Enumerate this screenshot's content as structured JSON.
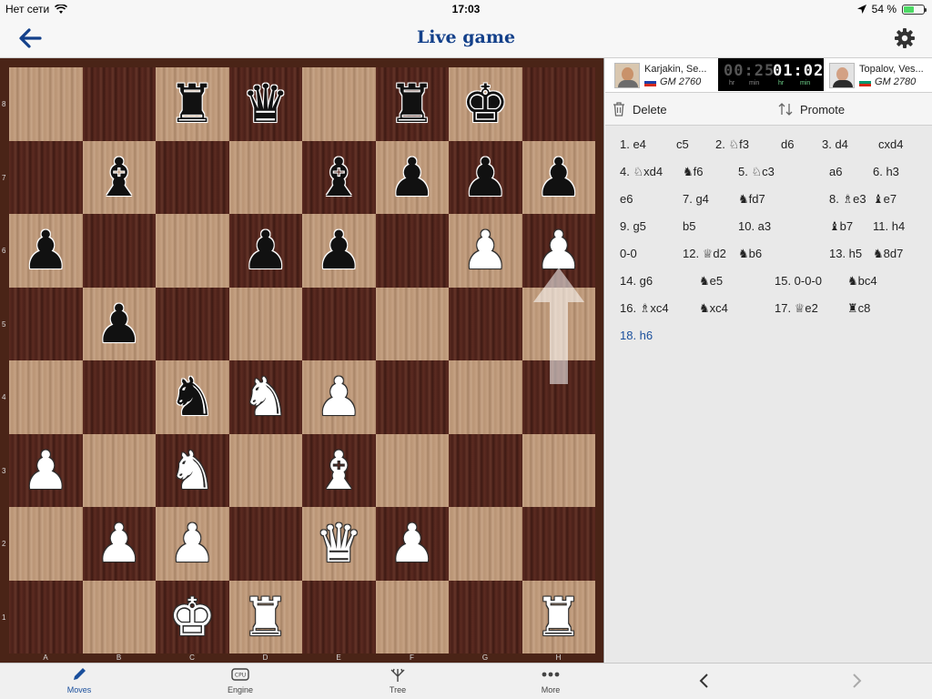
{
  "status_bar": {
    "network": "Нет сети",
    "time": "17:03",
    "battery_percent": "54 %",
    "battery_level": 0.54
  },
  "nav": {
    "title": "Live game"
  },
  "board": {
    "ranks": [
      "8",
      "7",
      "6",
      "5",
      "4",
      "3",
      "2",
      "1"
    ],
    "files": [
      "A",
      "B",
      "C",
      "D",
      "E",
      "F",
      "G",
      "H"
    ],
    "position": [
      [
        "",
        "",
        "bR",
        "bQ",
        "",
        "bR",
        "bK",
        ""
      ],
      [
        "",
        "bB",
        "",
        "",
        "bB",
        "bP",
        "bP",
        "bP"
      ],
      [
        "bP",
        "",
        "",
        "bP",
        "bP",
        "",
        "wP",
        "wP"
      ],
      [
        "",
        "bP",
        "",
        "",
        "",
        "",
        "",
        ""
      ],
      [
        "",
        "",
        "bN",
        "wN",
        "wP",
        "",
        "",
        ""
      ],
      [
        "wP",
        "",
        "wN",
        "",
        "wB",
        "",
        "",
        ""
      ],
      [
        "",
        "wP",
        "wP",
        "",
        "wQ",
        "wP",
        "",
        ""
      ],
      [
        "",
        "",
        "wK",
        "wR",
        "",
        "",
        "",
        "wR"
      ]
    ],
    "last_move": {
      "from": "h5",
      "to": "h6"
    }
  },
  "players": {
    "white": {
      "name": "Karjakin, Se...",
      "rating": "GM 2760",
      "flag": "ru"
    },
    "black": {
      "name": "Topalov, Ves...",
      "rating": "GM 2780",
      "flag": "bg"
    }
  },
  "clock": {
    "left": {
      "time": "00:25",
      "units": [
        "hr",
        "min"
      ],
      "color": "#555555"
    },
    "right": {
      "time": "01:02",
      "units": [
        "hr",
        "min"
      ],
      "color": "#ffffff"
    }
  },
  "toolbar": {
    "delete_label": "Delete",
    "promote_label": "Promote"
  },
  "moves": [
    [
      "1. e4",
      "c5",
      "2. ♘f3",
      "d6",
      "3. d4",
      "cxd4"
    ],
    [
      "4. ♘xd4",
      "♞f6",
      "5. ♘c3",
      "a6",
      "6. h3"
    ],
    [
      "e6",
      "7. g4",
      "♞fd7",
      "8. ♗e3",
      "♝e7"
    ],
    [
      "9. g5",
      "b5",
      "10. a3",
      "♝b7",
      "11. h4"
    ],
    [
      "0-0",
      "12. ♕d2",
      "♞b6",
      "13. h5",
      "♞8d7"
    ],
    [
      "14. g6",
      "♞e5",
      "15. 0-0-0",
      "♞bc4"
    ],
    [
      "16. ♗xc4",
      "♞xc4",
      "17. ♕e2",
      "♜c8"
    ],
    [
      "18. h6"
    ]
  ],
  "current_move": "18. h6",
  "tabs": [
    {
      "label": "Moves",
      "icon": "pencil-icon",
      "active": true
    },
    {
      "label": "Engine",
      "icon": "cpu-icon",
      "active": false
    },
    {
      "label": "Tree",
      "icon": "tree-icon",
      "active": false
    },
    {
      "label": "More",
      "icon": "more-dots-icon",
      "active": false
    }
  ],
  "colors": {
    "accent": "#13408a",
    "link": "#1a4f9c"
  }
}
